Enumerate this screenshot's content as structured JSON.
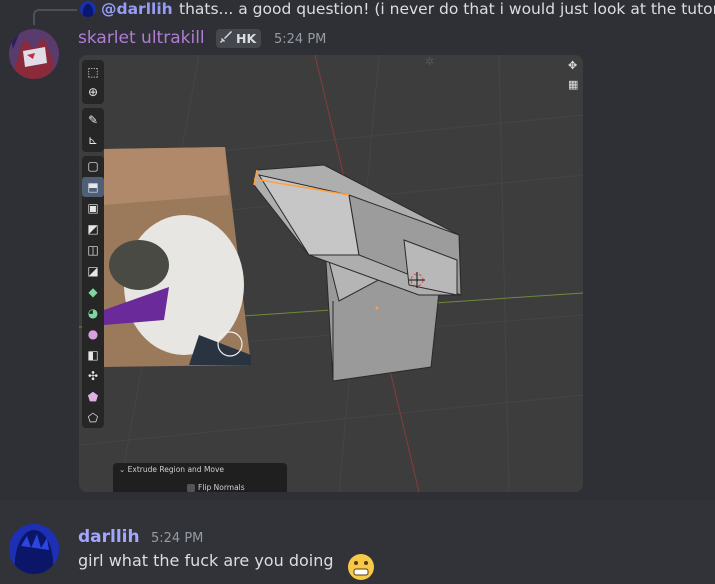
{
  "reply": {
    "mention": "@darllih",
    "text": "thats... a good question! (i never do that i would just look at the tutorial)"
  },
  "message1": {
    "author": "skarlet ultrakill",
    "guild_tag": "HK",
    "tag_icon": "sword-icon",
    "timestamp": "5:24 PM",
    "author_color": "#b07cd6"
  },
  "blender": {
    "operator_panel_title": "Extrude Region and Move",
    "flip_normals_label": "Flip Normals",
    "tools": [
      "select-box",
      "cursor",
      "annotate",
      "measure",
      "add-cube",
      "extrude-region",
      "inset-faces",
      "bevel",
      "loop-cut",
      "knife",
      "poly-build",
      "spin",
      "smooth",
      "edge-slide",
      "shrink-fatten",
      "shear",
      "rip-region"
    ]
  },
  "message2": {
    "author": "darllih",
    "timestamp": "5:24 PM",
    "text": "girl what the fuck are you doing",
    "emoji": "grimace-emoji",
    "author_color": "#a3a6ff"
  }
}
